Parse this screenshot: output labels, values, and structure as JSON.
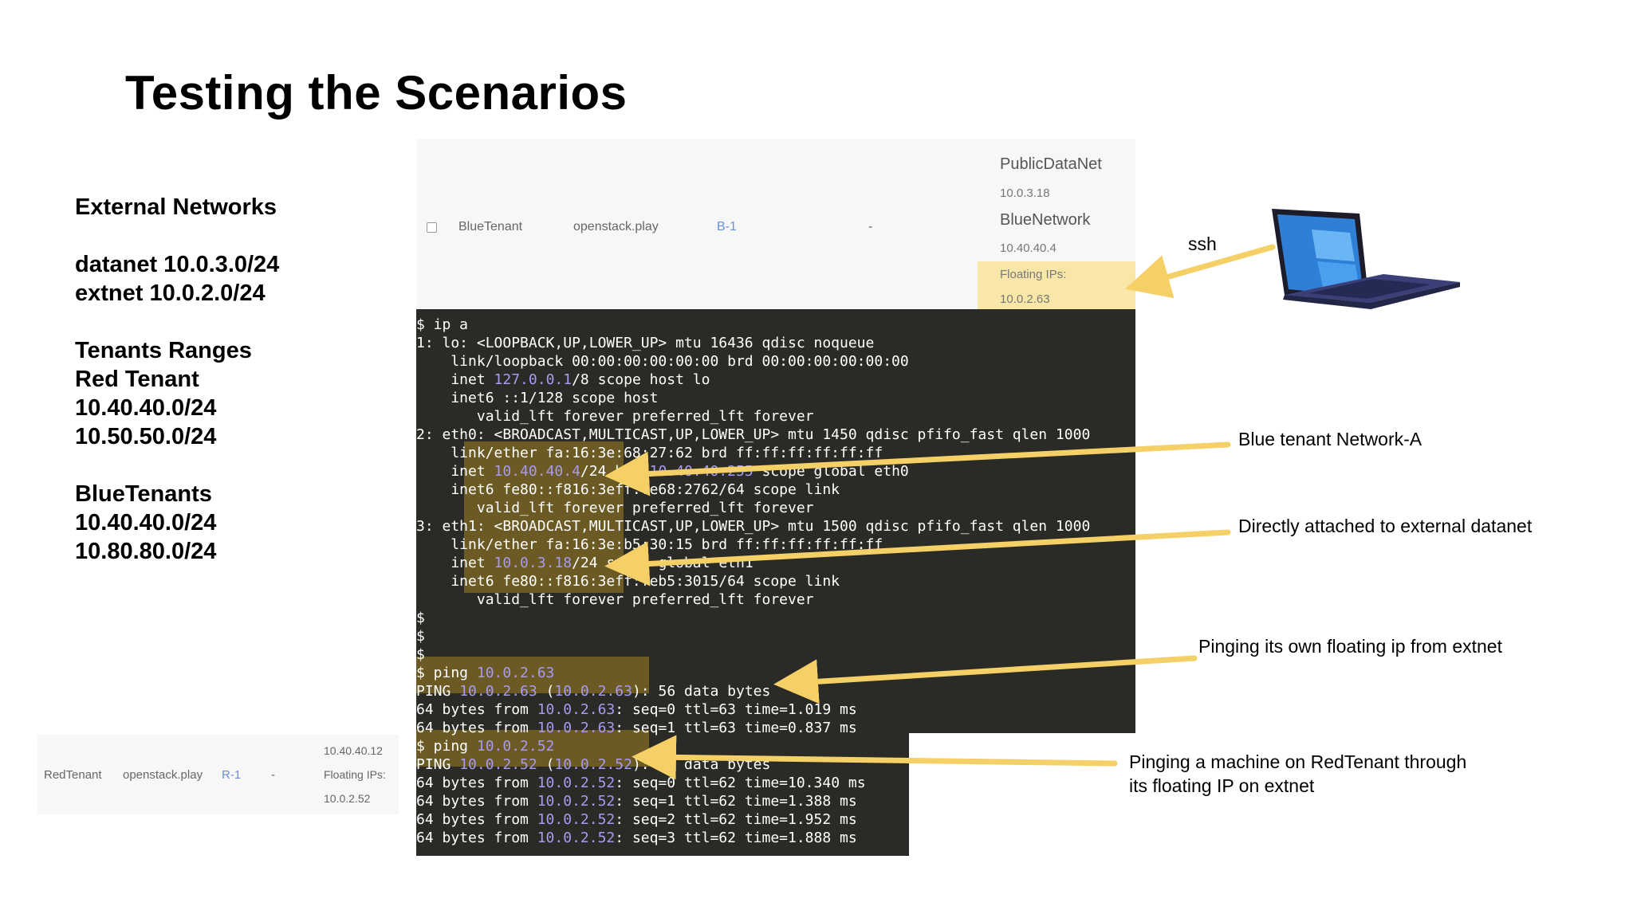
{
  "title": "Testing the Scenarios",
  "left_notes": {
    "external_heading": "External Networks",
    "datanet": "datanet 10.0.3.0/24",
    "extnet": "extnet 10.0.2.0/24",
    "tenants_heading": "Tenants Ranges",
    "red_tenant": "Red Tenant",
    "red_range_1": "10.40.40.0/24",
    "red_range_2": "10.50.50.0/24",
    "blue_heading": "BlueTenants",
    "blue_range_1": "10.40.40.0/24",
    "blue_range_2": "10.80.80.0/24"
  },
  "blue_panel": {
    "name": "BlueTenant",
    "image": "openstack.play",
    "router": "B-1",
    "dash": "-",
    "net1_name": "PublicDataNet",
    "net1_ip": "10.0.3.18",
    "net2_name": "BlueNetwork",
    "net2_ip": "10.40.40.4",
    "floating_label": "Floating IPs:",
    "floating_ip": "10.0.2.63"
  },
  "red_panel": {
    "name": "RedTenant",
    "image": "openstack.play",
    "router": "R-1",
    "dash": "-",
    "ip": "10.40.40.12",
    "floating_label": "Floating IPs:",
    "floating_ip": "10.0.2.52"
  },
  "terminal": {
    "lines": [
      "$ ip a",
      "1: lo: <LOOPBACK,UP,LOWER_UP> mtu 16436 qdisc noqueue",
      "    link/loopback 00:00:00:00:00:00 brd 00:00:00:00:00:00",
      "    inet 127.0.0.1/8 scope host lo",
      "    inet6 ::1/128 scope host",
      "       valid_lft forever preferred_lft forever",
      "2: eth0: <BROADCAST,MULTICAST,UP,LOWER_UP> mtu 1450 qdisc pfifo_fast qlen 1000",
      "    link/ether fa:16:3e:68:27:62 brd ff:ff:ff:ff:ff:ff",
      "    inet 10.40.40.4/24 brd 10.40.40.255 scope global eth0",
      "    inet6 fe80::f816:3eff:fe68:2762/64 scope link",
      "       valid_lft forever preferred_lft forever",
      "3: eth1: <BROADCAST,MULTICAST,UP,LOWER_UP> mtu 1500 qdisc pfifo_fast qlen 1000",
      "    link/ether fa:16:3e:b5:30:15 brd ff:ff:ff:ff:ff:ff",
      "    inet 10.0.3.18/24 scope global eth1",
      "    inet6 fe80::f816:3eff:feb5:3015/64 scope link",
      "       valid_lft forever preferred_lft forever",
      "$",
      "$",
      "$",
      "$ ping 10.0.2.63",
      "PING 10.0.2.63 (10.0.2.63): 56 data bytes",
      "64 bytes from 10.0.2.63: seq=0 ttl=63 time=1.019 ms",
      "64 bytes from 10.0.2.63: seq=1 ttl=63 time=0.837 ms",
      "$ ping 10.0.2.52",
      "PING 10.0.2.52 (10.0.2.52): 56 data bytes",
      "64 bytes from 10.0.2.52: seq=0 ttl=62 time=10.340 ms",
      "64 bytes from 10.0.2.52: seq=1 ttl=62 time=1.388 ms",
      "64 bytes from 10.0.2.52: seq=2 ttl=62 time=1.952 ms",
      "64 bytes from 10.0.2.52: seq=3 ttl=62 time=1.888 ms"
    ]
  },
  "annotations": {
    "ssh": "ssh",
    "blue_network": "Blue tenant Network-A",
    "datanet": "Directly attached to external datanet",
    "ping_own": "Pinging its own floating ip from extnet",
    "ping_red_1": "Pinging a machine on RedTenant through",
    "ping_red_2": "its floating IP on extnet"
  },
  "colors": {
    "arrow": "#f5d066",
    "terminal_bg": "#2a2a26",
    "terminal_highlight": "#6b5a23",
    "ip_highlight": "#a99af0",
    "panel_bg": "#f7f7f7"
  },
  "icons": [
    "laptop-icon",
    "checkbox-icon"
  ]
}
